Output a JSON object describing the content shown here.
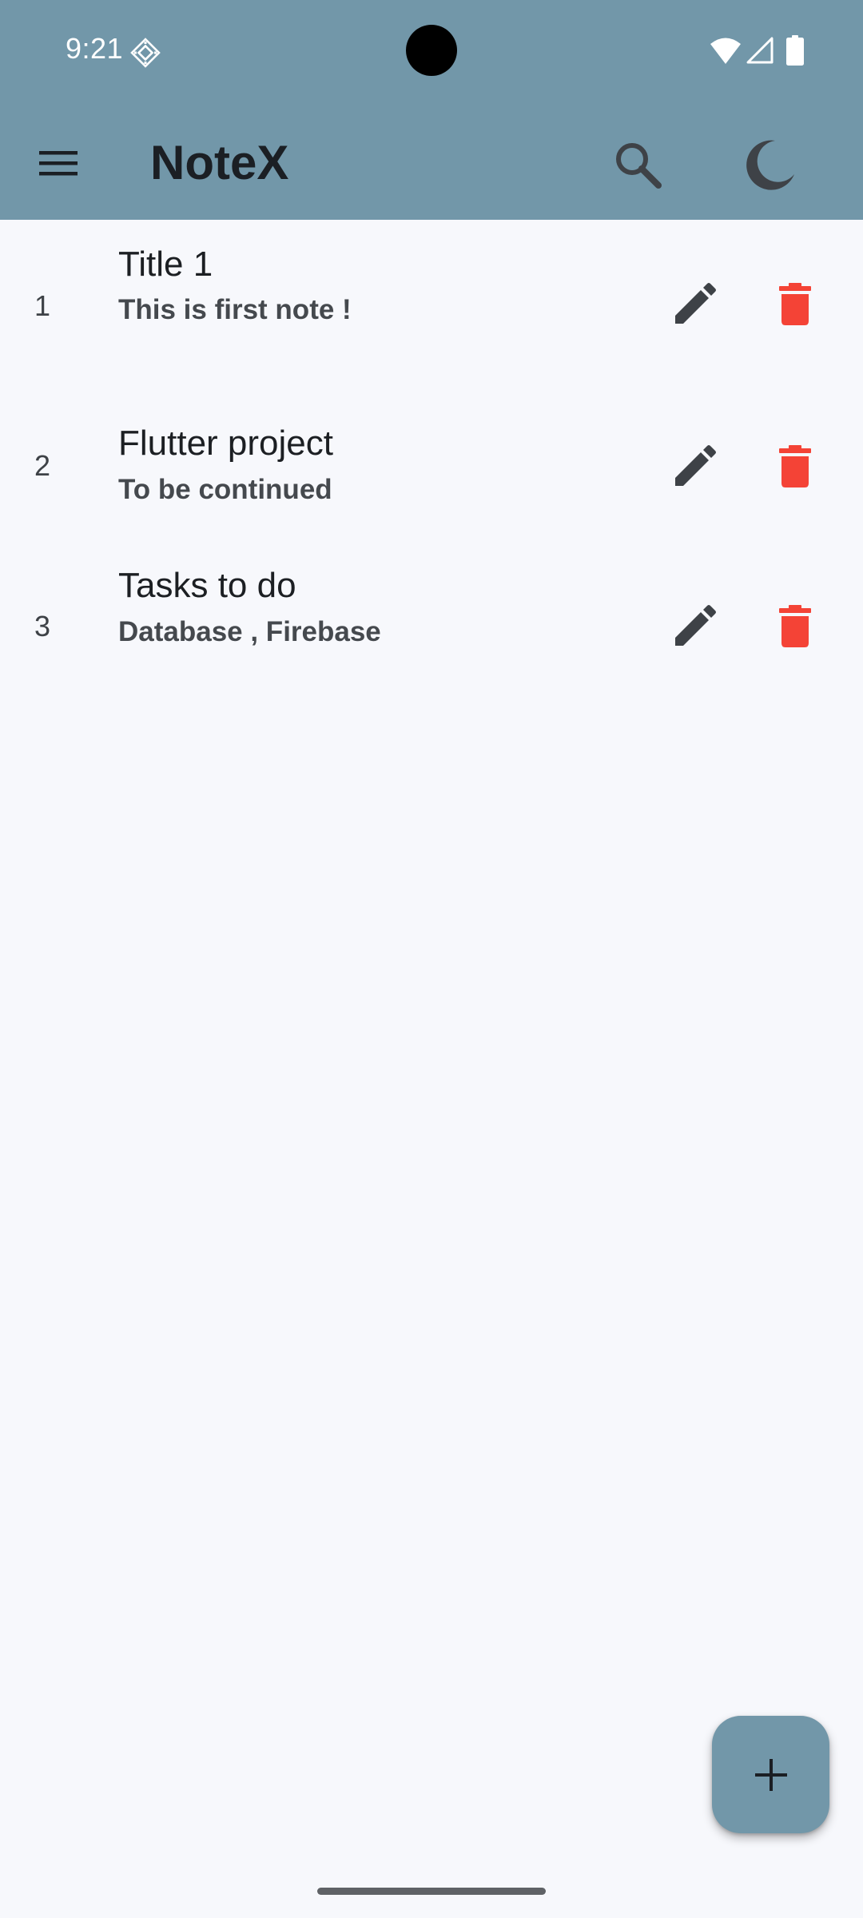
{
  "status_bar": {
    "time": "9:21",
    "icons": [
      "notification-app-icon",
      "wifi-icon",
      "signal-icon",
      "battery-icon"
    ]
  },
  "app_bar": {
    "title": "NoteX",
    "icons": [
      "menu-icon",
      "search-icon",
      "dark-mode-moon-icon"
    ]
  },
  "notes": [
    {
      "number": "1",
      "title": "Title 1",
      "subtitle": "This is first note !"
    },
    {
      "number": "2",
      "title": "Flutter project",
      "subtitle": "To be continued"
    },
    {
      "number": "3",
      "title": "Tasks to do",
      "subtitle": "Database , Firebase"
    }
  ],
  "fab": {
    "icon": "add-icon"
  },
  "colors": {
    "app_bar": "#7297A9",
    "background": "#F7F8FC",
    "title_text": "#1B1F24",
    "icon_dark": "#3E4247",
    "delete_red": "#F44336",
    "fab": "#7297A9"
  }
}
